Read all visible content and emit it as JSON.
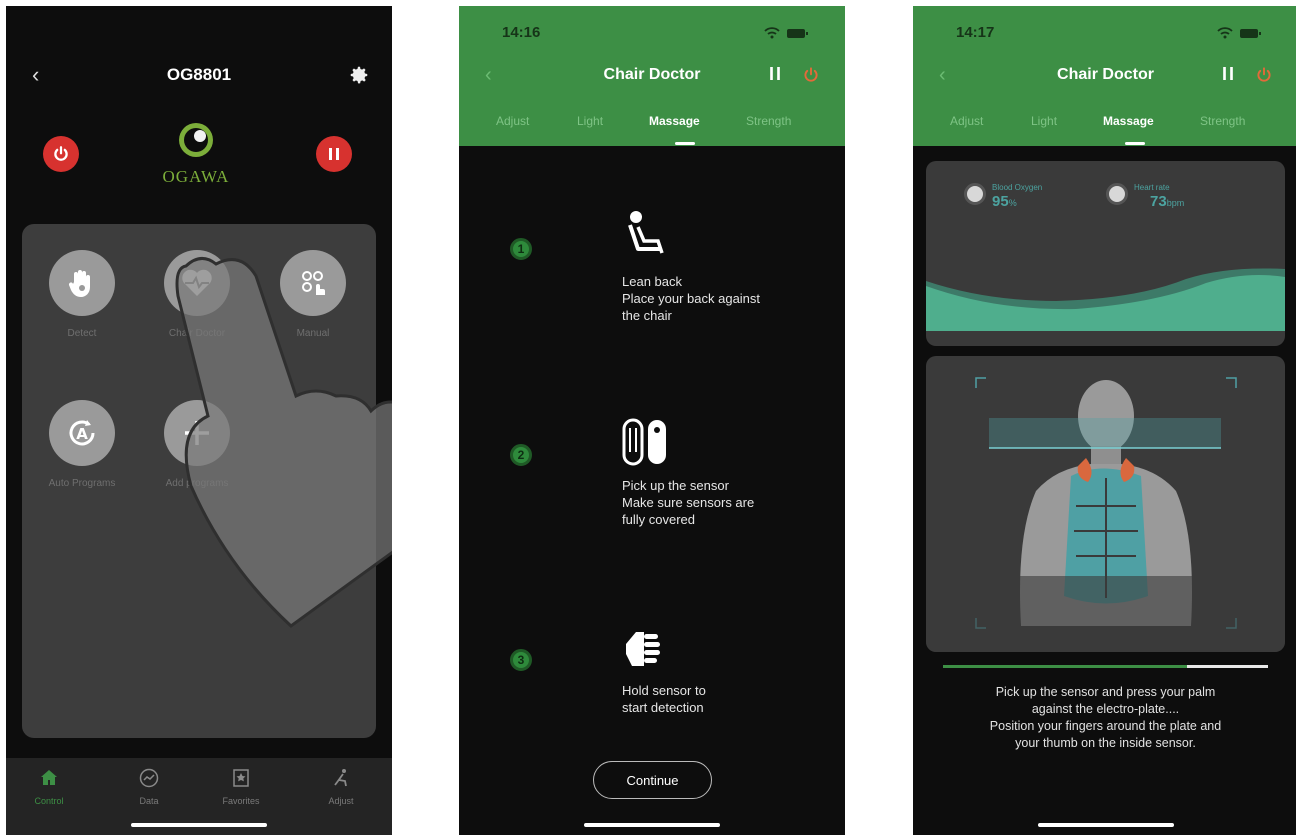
{
  "phone1": {
    "title": "OG8801",
    "back_icon": "‹",
    "logo_text": "OGAWA",
    "modes": [
      {
        "label": "Detect",
        "icon": "hand-detect-icon"
      },
      {
        "label": "Chair Doctor",
        "icon": "heart-rate-icon"
      },
      {
        "label": "Manual",
        "icon": "manual-touch-icon"
      },
      {
        "label": "Auto Programs",
        "icon": "auto-program-icon"
      },
      {
        "label": "Add programs",
        "icon": "plus-icon"
      }
    ],
    "tabs": [
      {
        "label": "Control",
        "icon": "home-icon",
        "active": true
      },
      {
        "label": "Data",
        "icon": "chart-icon"
      },
      {
        "label": "Favorites",
        "icon": "star-icon"
      },
      {
        "label": "Adjust",
        "icon": "chair-icon"
      }
    ],
    "colors": {
      "accent_red": "#d7322f",
      "brand_green": "#7cae3a"
    }
  },
  "phone2": {
    "status_time": "14:16",
    "title": "Chair Doctor",
    "back_icon": "‹",
    "pause_icon": "II",
    "tabs": [
      "Adjust",
      "Light",
      "Massage",
      "Strength"
    ],
    "active_tab": "Massage",
    "steps": [
      {
        "num": "1",
        "lines": [
          "Lean back",
          "Place your back against",
          "the chair"
        ]
      },
      {
        "num": "2",
        "lines": [
          "Pick up the sensor",
          "Make sure sensors are",
          "fully covered"
        ]
      },
      {
        "num": "3",
        "lines": [
          "Hold sensor to",
          "start detection"
        ]
      }
    ],
    "continue_label": "Continue"
  },
  "phone3": {
    "status_time": "14:17",
    "title": "Chair Doctor",
    "back_icon": "‹",
    "pause_icon": "II",
    "tabs": [
      "Adjust",
      "Light",
      "Massage",
      "Strength"
    ],
    "active_tab": "Massage",
    "metrics": [
      {
        "label": "Blood Oxygen",
        "value": "95",
        "unit": "%"
      },
      {
        "label": "Heart rate",
        "value": "73",
        "unit": "bpm"
      }
    ],
    "progress": 0.75,
    "instruction_lines": [
      "Pick up the sensor and press your palm",
      "against the electro-plate....",
      "Position your fingers around the plate and",
      "your thumb on the inside sensor."
    ],
    "colors": {
      "header_green": "#3d8f45",
      "wave_teal": "#4fae8d",
      "muscle_teal": "#4fa0a4",
      "neck_red": "#d9683e"
    }
  }
}
